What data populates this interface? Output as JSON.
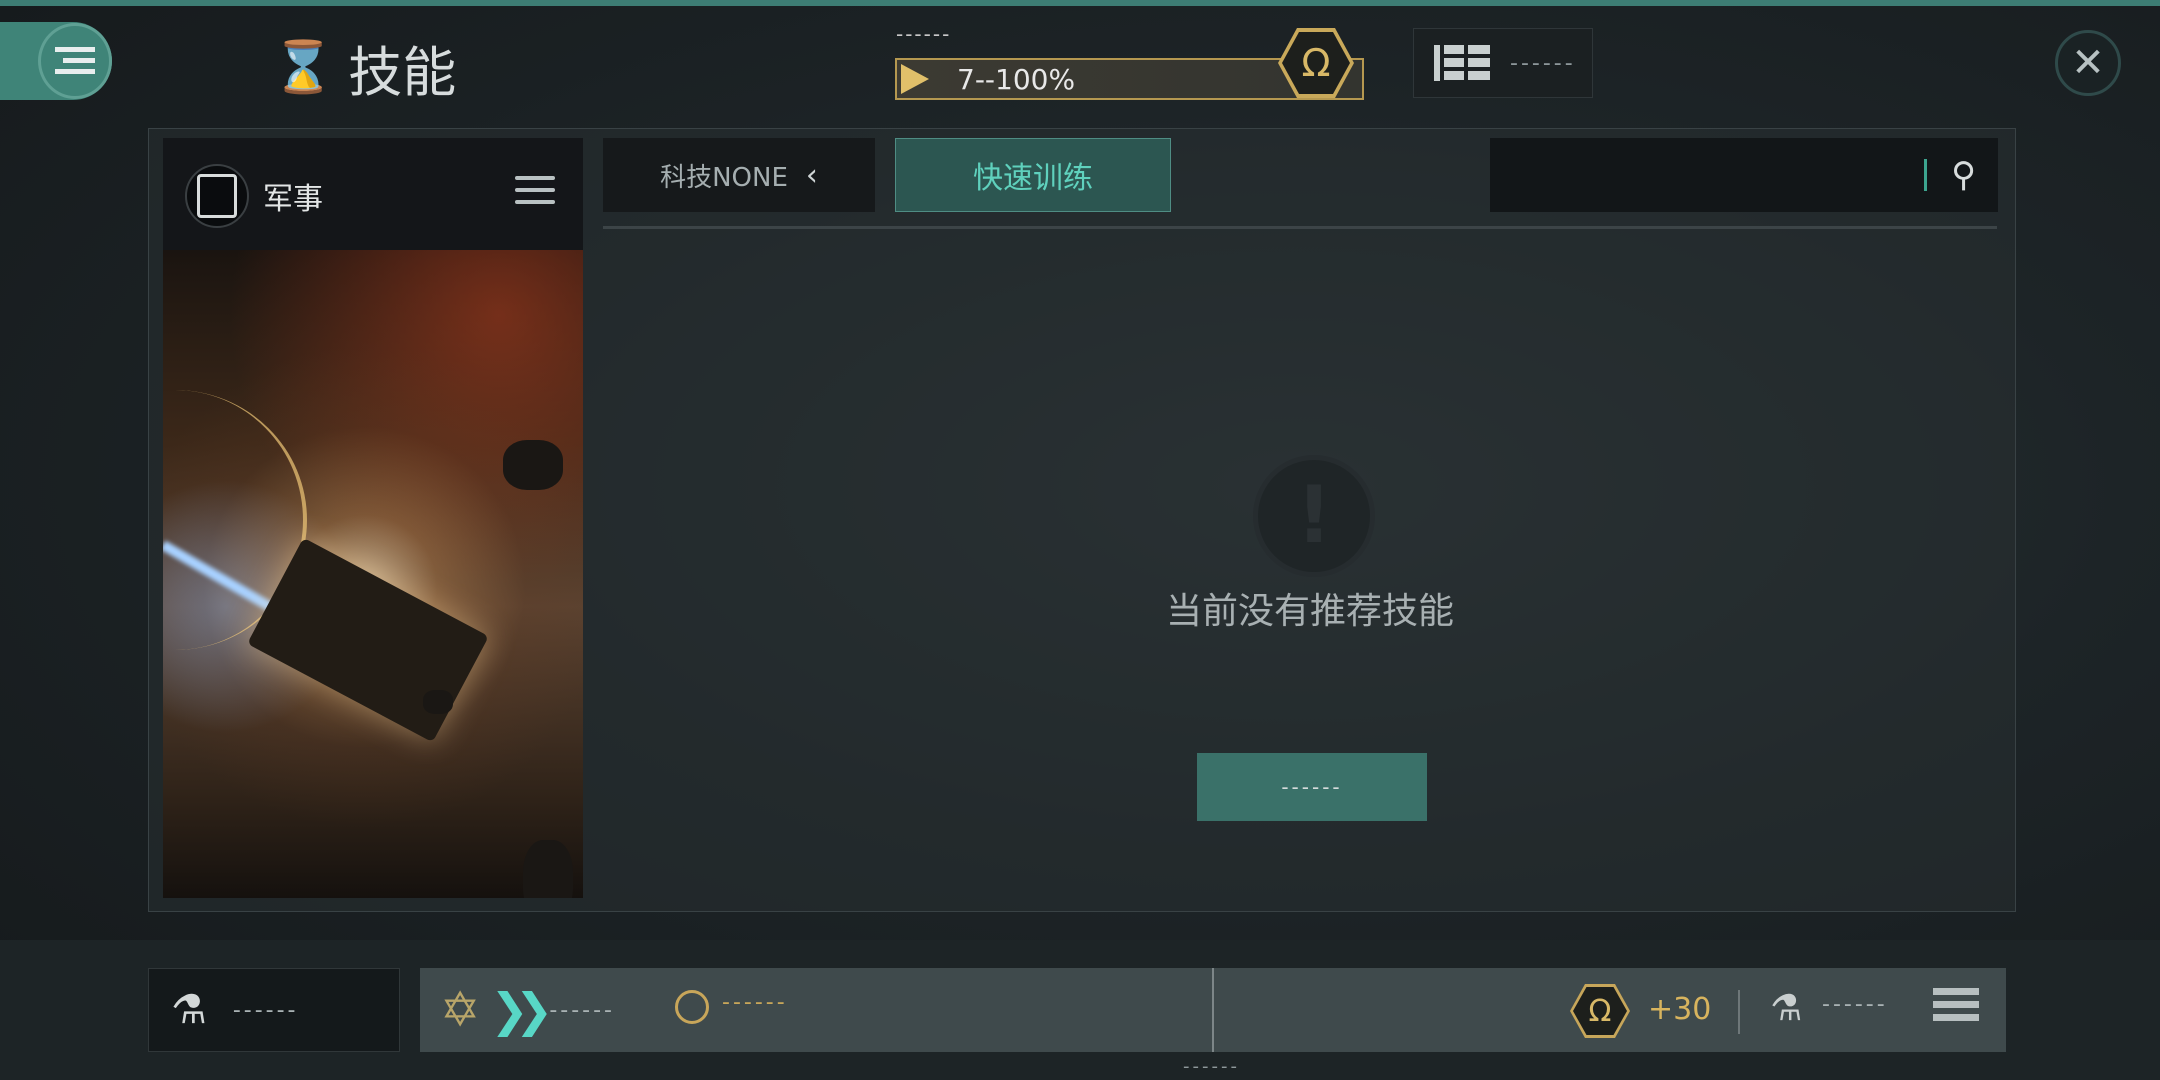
{
  "header": {
    "title": "技能",
    "progress": {
      "top_label": "------",
      "text": "7--100%",
      "value_percent": 100
    },
    "progress_icon": "Ω",
    "top_panel_text": "------",
    "close_glyph": "✕"
  },
  "sidebar": {
    "title": "军事"
  },
  "tabs": {
    "tech_label": "科技NONE",
    "tech_chevron": "‹",
    "quick_label": "快速训练"
  },
  "search": {
    "placeholder": ""
  },
  "empty_state": {
    "icon": "!",
    "message": "当前没有推荐技能",
    "button_label": "------"
  },
  "bottom_bar": {
    "left_text": "------",
    "queue_text": "------",
    "time_text": "------",
    "omega_symbol": "Ω",
    "bonus": "+30",
    "right_text": "------",
    "bottom_dash": "------"
  },
  "icons": [
    "menu-icon",
    "dna-icon",
    "omega-icon",
    "list-icon",
    "close-icon",
    "avatar-icon",
    "hamburger-icon",
    "chevron-left-icon",
    "search-icon",
    "alert-icon",
    "injector-refresh-icon",
    "star-icon",
    "chevrons-icon",
    "clock-icon",
    "injector-icon"
  ],
  "colors": {
    "accent": "#3f8478",
    "gold": "#c9a95a",
    "cyan": "#58d7c6"
  }
}
